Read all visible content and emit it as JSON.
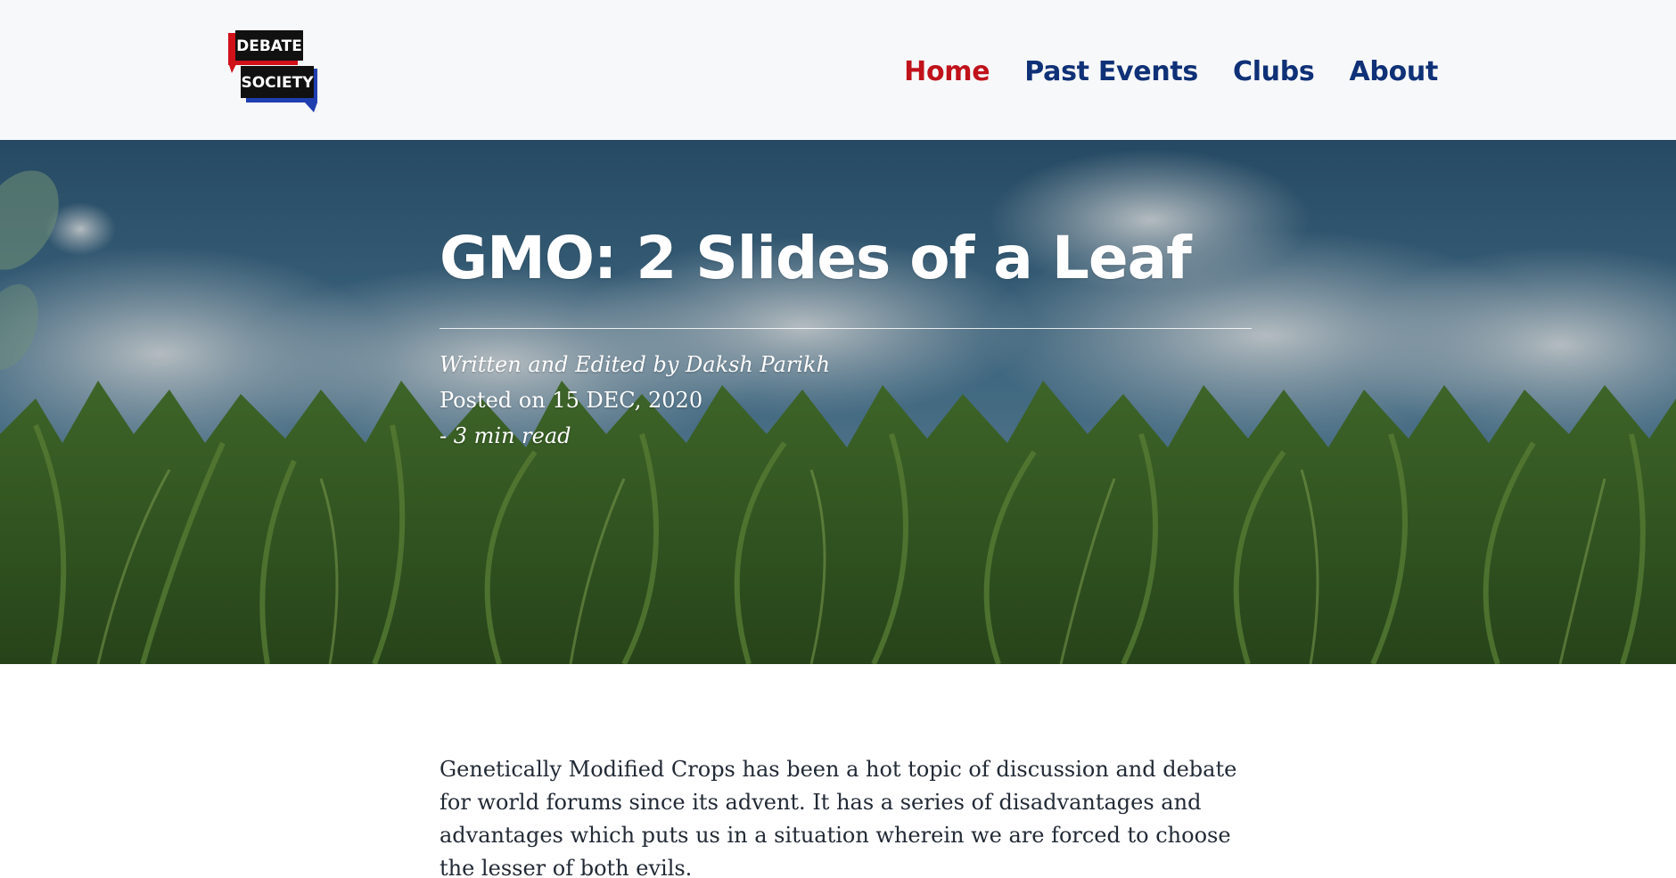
{
  "header": {
    "logo": {
      "line1": "DEBATE",
      "line2": "SOCIETY"
    },
    "nav": [
      {
        "label": "Home",
        "active": true
      },
      {
        "label": "Past Events",
        "active": false
      },
      {
        "label": "Clubs",
        "active": false
      },
      {
        "label": "About",
        "active": false
      }
    ]
  },
  "hero": {
    "title": "GMO: 2 Slides of a Leaf",
    "author_line": "Written and Edited by Daksh Parikh",
    "posted_line": "Posted on 15 DEC, 2020",
    "read_time": "- 3 min read",
    "background": "cornfield-sky-image"
  },
  "article": {
    "intro": "Genetically Modified Crops has been a hot topic of discussion and debate for world forums since its advent. It has a series of disadvantages and advantages which puts us in a situation wherein we are forced to choose the lesser of both evils."
  },
  "colors": {
    "nav_active": "#c0121b",
    "nav_link": "#0f3177",
    "header_bg": "#f7f8f9",
    "body_text": "#222a35"
  }
}
